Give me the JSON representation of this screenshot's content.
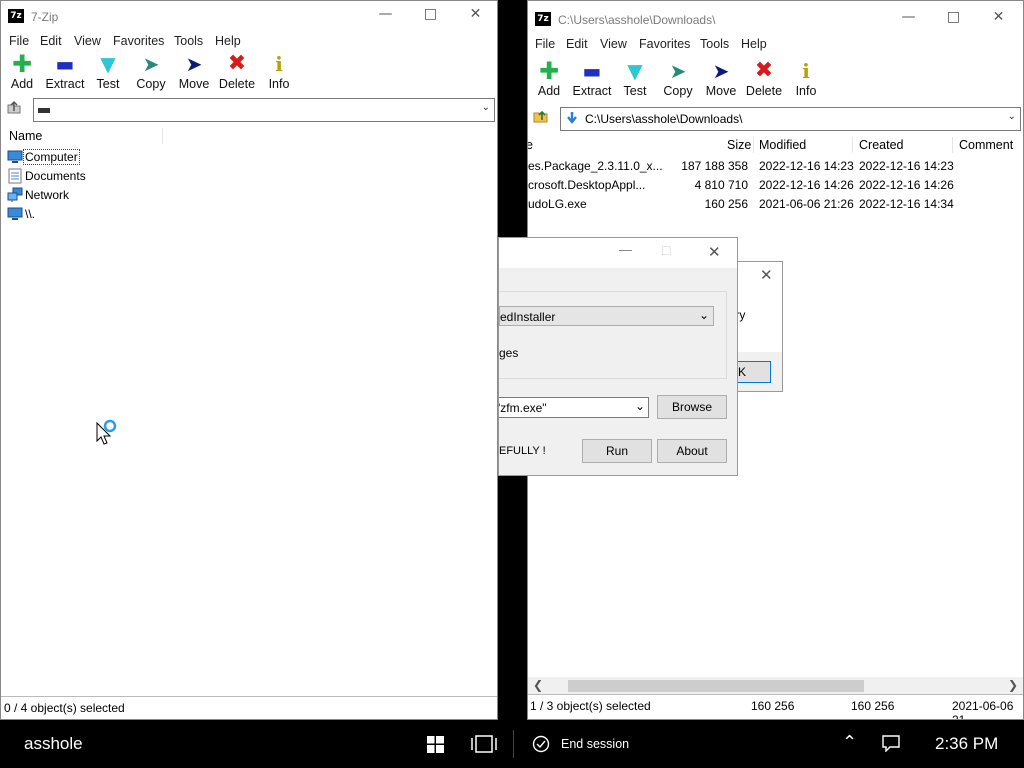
{
  "left_window": {
    "title": "7-Zip",
    "menu": [
      "File",
      "Edit",
      "View",
      "Favorites",
      "Tools",
      "Help"
    ],
    "toolbar": [
      "Add",
      "Extract",
      "Test",
      "Copy",
      "Move",
      "Delete",
      "Info"
    ],
    "address_value": "",
    "column_name": "Name",
    "items": [
      "Computer",
      "Documents",
      "Network",
      "\\\\."
    ],
    "status": "0 / 4 object(s) selected"
  },
  "right_window": {
    "title": "C:\\Users\\asshole\\Downloads\\",
    "menu": [
      "File",
      "Edit",
      "View",
      "Favorites",
      "Tools",
      "Help"
    ],
    "toolbar": [
      "Add",
      "Extract",
      "Test",
      "Copy",
      "Move",
      "Delete",
      "Info"
    ],
    "address_value": "C:\\Users\\asshole\\Downloads\\",
    "columns": {
      "name": "e",
      "size": "Size",
      "modified": "Modified",
      "created": "Created",
      "comment": "Comment"
    },
    "files": [
      {
        "name": "es.Package_2.3.11.0_x...",
        "size": "187 188 358",
        "modified": "2022-12-16 14:23",
        "created": "2022-12-16 14:23"
      },
      {
        "name": "crosoft.DesktopAppl...",
        "size": "4 810 710",
        "modified": "2022-12-16 14:26",
        "created": "2022-12-16 14:26"
      },
      {
        "name": "udoLG.exe",
        "size": "160 256",
        "modified": "2021-06-06 21:26",
        "created": "2022-12-16 14:34"
      }
    ],
    "status": {
      "selected": "1 / 3 object(s) selected",
      "size1": "160 256",
      "size2": "160 256",
      "date": "2021-06-06 21"
    }
  },
  "dialog": {
    "dropdown_value": "edInstaller",
    "text_ges": "ges",
    "path_value": "'zfm.exe\"",
    "browse_label": "Browse",
    "warning_text": "EFULLY !",
    "run_label": "Run",
    "about_label": "About"
  },
  "message_box": {
    "text": "try",
    "ok_label": "K"
  },
  "taskbar": {
    "user": "asshole",
    "end_session": "End session",
    "time": "2:36 PM"
  },
  "colors": {
    "green": "#22b14c",
    "blue": "#1f2fbf",
    "cyan": "#2ec7d6",
    "red": "#d81a1a",
    "darkblue": "#0d1a7a"
  }
}
